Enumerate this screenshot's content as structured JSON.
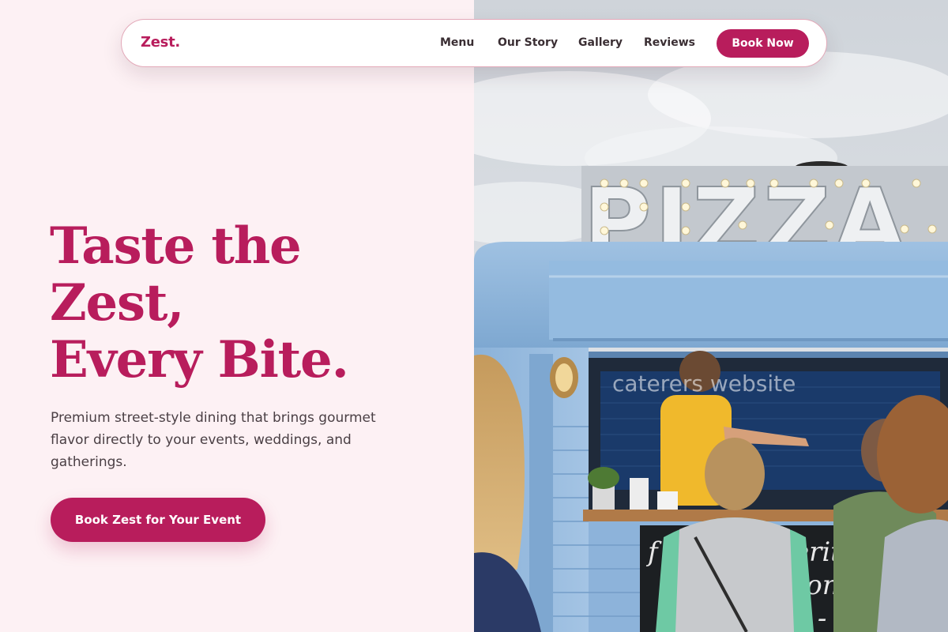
{
  "nav": {
    "logo": "Zest.",
    "links": [
      {
        "label": "Menu"
      },
      {
        "label": "Our Story"
      },
      {
        "label": "Gallery"
      },
      {
        "label": "Reviews"
      }
    ],
    "cta_label": "Book Now"
  },
  "hero": {
    "title_lines": [
      "Taste the",
      "Zest,",
      "Every Bite."
    ],
    "subtitle": "Premium street-style dining that brings gourmet flavor directly to your events, weddings, and gatherings.",
    "cta_label": "Book Zest for Your Event",
    "image": {
      "sign_text": "PIZZA",
      "watermark": "caterers website",
      "menu_board_text": [
        "f",
        "erit",
        "roni",
        "e -"
      ]
    }
  },
  "colors": {
    "brand": "#b81d5c",
    "background": "#fdf1f4",
    "text": "#3a2e33",
    "truck_blue": "#8cb3d8"
  }
}
